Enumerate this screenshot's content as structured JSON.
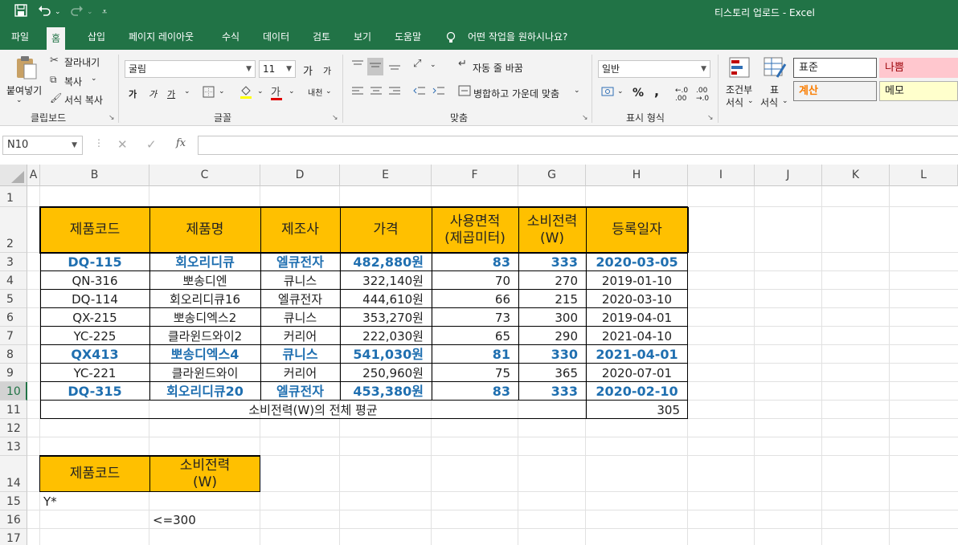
{
  "titlebar": {
    "title": "티스토리 업로드  -  Excel",
    "save_icon": "save-icon",
    "undo_icon": "undo-icon",
    "redo_icon": "redo-icon",
    "customize_icon": "customize-qat-icon"
  },
  "tabs": [
    "파일",
    "홈",
    "삽입",
    "페이지 레이아웃",
    "수식",
    "데이터",
    "검토",
    "보기",
    "도움말"
  ],
  "active_tab": "홈",
  "tell_me": "어떤 작업을 원하시나요?",
  "ribbon": {
    "clipboard": {
      "paste": "붙여넣기",
      "cut": "잘라내기",
      "copy": "복사",
      "format_painter": "서식 복사",
      "label": "클립보드"
    },
    "font": {
      "name": "굴림",
      "size": "11",
      "label": "글꼴",
      "bold": "가",
      "italic": "가",
      "underline": "가",
      "grow": "가",
      "shrink": "가",
      "phonetic": "내천"
    },
    "alignment": {
      "wrap": "자동 줄 바꿈",
      "merge": "병합하고 가운데 맞춤",
      "label": "맞춤"
    },
    "number": {
      "format": "일반",
      "percent": "%",
      "comma": ",",
      "label": "표시 형식"
    },
    "styles": {
      "conditional": "조건부",
      "conditional2": "서식",
      "table": "표",
      "table2": "서식",
      "normal": "표준",
      "bad": "나쁨",
      "calc": "계산",
      "memo": "메모"
    }
  },
  "formula_bar": {
    "name_box": "N10",
    "fx": "fx",
    "cancel": "✕",
    "enter": "✓",
    "value": ""
  },
  "columns": [
    "A",
    "B",
    "C",
    "D",
    "E",
    "F",
    "G",
    "H",
    "I",
    "J",
    "K",
    "L"
  ],
  "rows": [
    "1",
    "2",
    "3",
    "4",
    "5",
    "6",
    "7",
    "8",
    "9",
    "10",
    "11",
    "12",
    "13",
    "14",
    "15",
    "16",
    "17"
  ],
  "selected_row": "10",
  "table": {
    "headers": [
      "제품코드",
      "제품명",
      "제조사",
      "가격",
      "사용면적\n(제곱미터)",
      "소비전력\n(W)",
      "등록일자"
    ],
    "rows": [
      {
        "highlight": true,
        "cells": [
          "DQ-115",
          "회오리디큐",
          "엘큐전자",
          "482,880원",
          "83",
          "333",
          "2020-03-05"
        ]
      },
      {
        "highlight": false,
        "cells": [
          "QN-316",
          "뽀송디엔",
          "큐니스",
          "322,140원",
          "70",
          "270",
          "2019-01-10"
        ]
      },
      {
        "highlight": false,
        "cells": [
          "DQ-114",
          "회오리디큐16",
          "엘큐전자",
          "444,610원",
          "66",
          "215",
          "2020-03-10"
        ]
      },
      {
        "highlight": false,
        "cells": [
          "QX-215",
          "뽀송디엑스2",
          "큐니스",
          "353,270원",
          "73",
          "300",
          "2019-04-01"
        ]
      },
      {
        "highlight": false,
        "cells": [
          "YC-225",
          "클라윈드와이2",
          "커리어",
          "222,030원",
          "65",
          "290",
          "2021-04-10"
        ]
      },
      {
        "highlight": true,
        "cells": [
          "QX413",
          "뽀송디엑스4",
          "큐니스",
          "541,030원",
          "81",
          "330",
          "2021-04-01"
        ]
      },
      {
        "highlight": false,
        "cells": [
          "YC-221",
          "클라윈드와이",
          "커리어",
          "250,960원",
          "75",
          "365",
          "2020-07-01"
        ]
      },
      {
        "highlight": true,
        "cells": [
          "DQ-315",
          "회오리디큐20",
          "엘큐전자",
          "453,380원",
          "83",
          "333",
          "2020-02-10"
        ]
      }
    ],
    "summary_label": "소비전력(W)의 전체 평균",
    "summary_value": "305"
  },
  "criteria": {
    "headers": [
      "제품코드",
      "소비전력\n(W)"
    ],
    "row1": [
      "Y*",
      ""
    ],
    "row2": [
      "",
      "<=300"
    ]
  },
  "colors": {
    "excel_green": "#217346",
    "header_fill": "#ffc000",
    "highlight_text": "#1f6fb0",
    "bad_fill": "#ffc7ce",
    "memo_fill": "#ffffcc",
    "calc_fill": "#f2f2f2"
  }
}
